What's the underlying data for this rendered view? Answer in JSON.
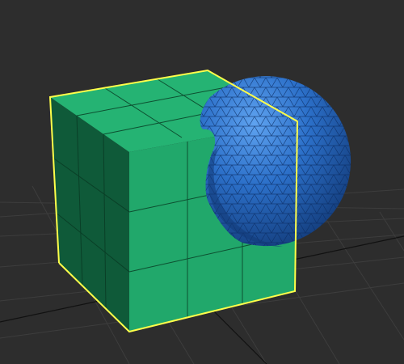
{
  "viewport": {
    "background_color": "#2d2d2d",
    "grid_color": "#3d3d3d",
    "grid_axis_color": "#111111"
  },
  "objects": {
    "box": {
      "type": "box",
      "front_color": "#21a86b",
      "side_color": "#0f5a39",
      "top_color": "#25b373",
      "edge_color": "#0d4f30",
      "selected": true,
      "selection_color": "#ffff4a",
      "segments": {
        "length": 4,
        "width": 3,
        "height": 3
      }
    },
    "sphere": {
      "type": "geosphere",
      "color": "#2a6fc7",
      "highlight_color": "#4b93e6",
      "shadow_color": "#123a78",
      "wire_color": "#0a2c63",
      "selected": false
    }
  },
  "boolean_operation": "subtract"
}
